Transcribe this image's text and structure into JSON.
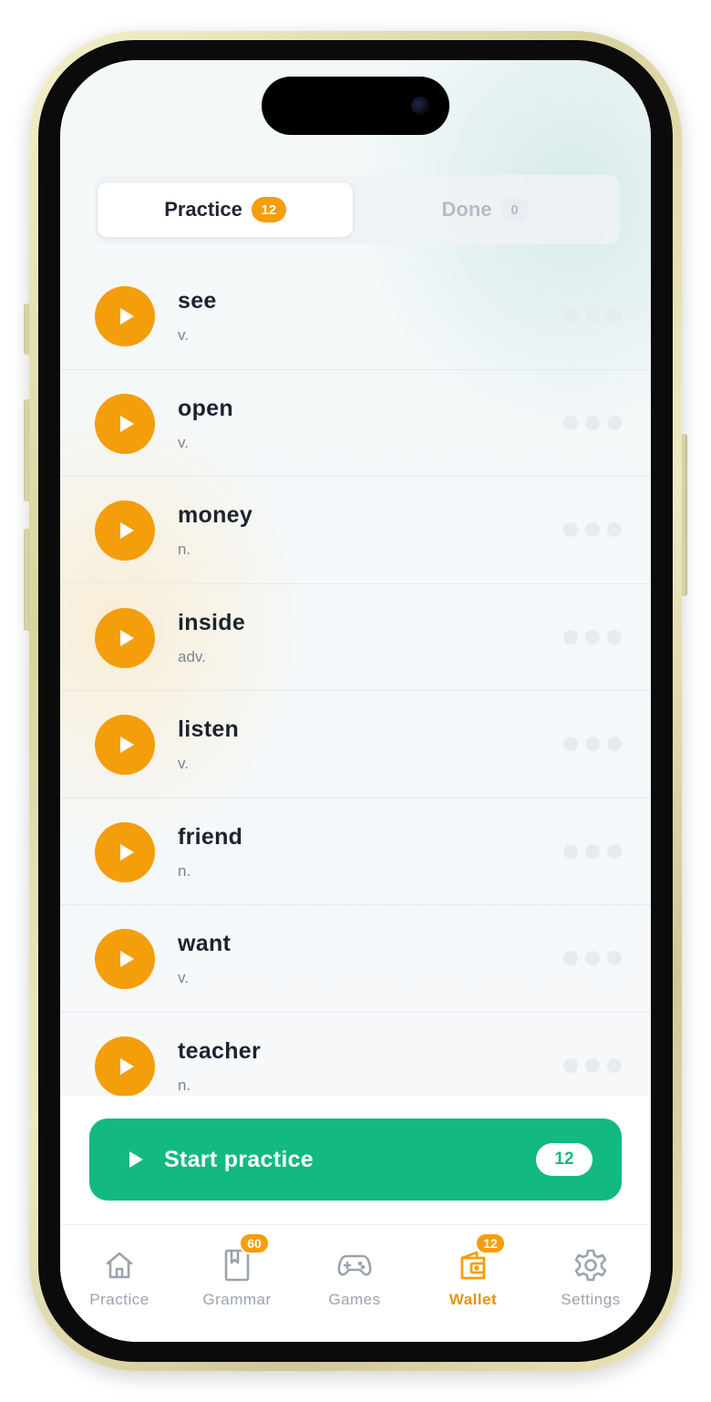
{
  "segmented": {
    "practice_label": "Practice",
    "practice_count": "12",
    "done_label": "Done",
    "done_count": "0"
  },
  "words": [
    {
      "word": "see",
      "pos": "v."
    },
    {
      "word": "open",
      "pos": "v."
    },
    {
      "word": "money",
      "pos": "n."
    },
    {
      "word": "inside",
      "pos": "adv."
    },
    {
      "word": "listen",
      "pos": "v."
    },
    {
      "word": "friend",
      "pos": "n."
    },
    {
      "word": "want",
      "pos": "v."
    },
    {
      "word": "teacher",
      "pos": "n."
    }
  ],
  "cta": {
    "label": "Start practice",
    "count": "12"
  },
  "tabbar": {
    "items": [
      {
        "label": "Practice",
        "icon": "home-icon",
        "badge": "",
        "active": false
      },
      {
        "label": "Grammar",
        "icon": "book-icon",
        "badge": "60",
        "active": false
      },
      {
        "label": "Games",
        "icon": "gamepad-icon",
        "badge": "",
        "active": false
      },
      {
        "label": "Wallet",
        "icon": "wallet-icon",
        "badge": "12",
        "active": true
      },
      {
        "label": "Settings",
        "icon": "gear-icon",
        "badge": "",
        "active": false
      }
    ]
  },
  "colors": {
    "accent_orange": "#f59e0b",
    "accent_green": "#12b981",
    "text_dark": "#1c2230",
    "text_muted": "#7b8493"
  }
}
